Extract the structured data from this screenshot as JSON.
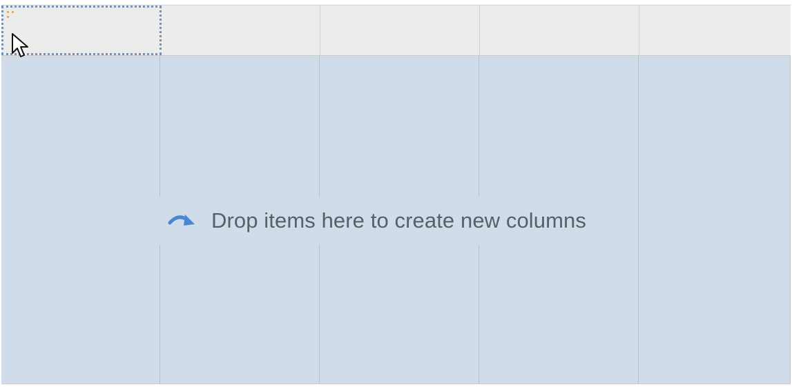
{
  "drop_zone": {
    "hint_text": "Drop items here to create new columns",
    "hint_icon": "curved-arrow-right-icon"
  },
  "grid": {
    "column_count": 5,
    "selected_column_index": 0
  },
  "colors": {
    "drop_zone_background": "#d0dce9",
    "header_background": "#ececec",
    "selection_border": "#6b92c8",
    "arrow": "#4a86d4",
    "hint_text": "#5a5f66"
  }
}
